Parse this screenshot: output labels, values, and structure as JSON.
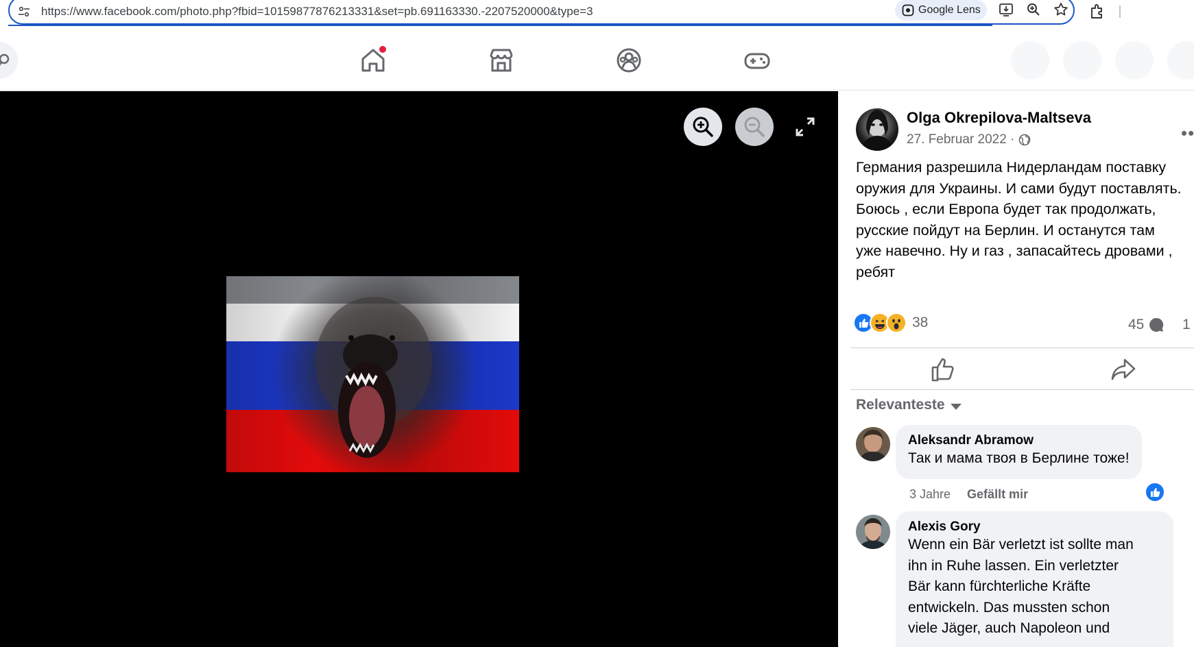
{
  "browser": {
    "url": "https://www.facebook.com/photo.php?fbid=10159877876213331&set=pb.691163330.-2207520000&type=3",
    "lens_label": "Google Lens",
    "icons": [
      "tune-icon",
      "lens-icon",
      "install-icon",
      "zoom-icon",
      "star-icon",
      "extensions-icon"
    ]
  },
  "nav": {
    "tabs": [
      "home-icon",
      "marketplace-icon",
      "groups-icon",
      "gaming-icon"
    ],
    "home_has_notification": true
  },
  "viewer": {
    "controls": [
      "zoom-in-icon",
      "zoom-out-icon",
      "fullscreen-icon"
    ],
    "photo": {
      "flag_colors": [
        "#f4f4f4",
        "#1b38c9",
        "#e30b0b"
      ]
    }
  },
  "post": {
    "author": "Olga Okrepilova-Maltseva",
    "date": "27. Februar 2022 ·",
    "privacy_icon": "globe-icon",
    "text_lines": [
      "Германия разрешила Нидерландам поставку",
      "оружия для Украины. И сами будут поставлять.",
      "Боюсь , если Европа будет так продолжать,",
      "русские пойдут на Берлин. И останутся там",
      "уже навечно. Ну и газ , запасайтесь дровами ,",
      "ребят"
    ],
    "reaction_count": "38",
    "comment_count": "45",
    "share_count": "1",
    "reaction_icons": [
      "like-reaction-icon",
      "haha-reaction-icon",
      "wow-reaction-icon"
    ]
  },
  "comments": {
    "sort_label": "Relevanteste",
    "items": [
      {
        "name": "Aleksandr Abramow",
        "text_lines": [
          "Так и мама твоя в Берлине тоже!"
        ],
        "time": "3 Jahre",
        "like_label": "Gefällt mir"
      },
      {
        "name": "Alexis Gory",
        "text_lines": [
          "Wenn ein Bär verletzt ist sollte man",
          "ihn in Ruhe lassen. Ein verletzter",
          "Bär kann fürchterliche Kräfte",
          "entwickeln. Das mussten schon",
          "viele Jäger, auch Napoleon und"
        ]
      }
    ]
  },
  "colors": {
    "facebook_blue": "#1877f2",
    "omnibox_border": "#1a56c4",
    "notification_red": "#e41e3f",
    "secondary_text": "#65676b"
  }
}
